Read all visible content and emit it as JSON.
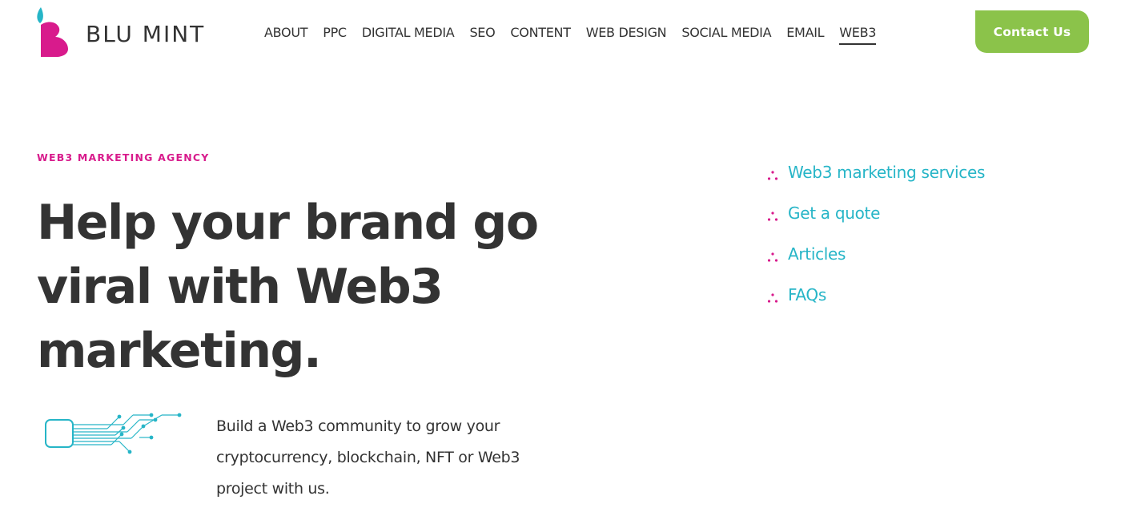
{
  "brand": {
    "name": "BLU MINT",
    "colors": {
      "pink": "#d81b8c",
      "teal": "#26b5c7",
      "green": "#8bc34a",
      "dark": "#333333"
    }
  },
  "nav": {
    "items": [
      {
        "label": "ABOUT"
      },
      {
        "label": "PPC"
      },
      {
        "label": "DIGITAL MEDIA"
      },
      {
        "label": "SEO"
      },
      {
        "label": "CONTENT"
      },
      {
        "label": "WEB DESIGN"
      },
      {
        "label": "SOCIAL MEDIA"
      },
      {
        "label": "EMAIL"
      },
      {
        "label": "WEB3",
        "active": true
      }
    ],
    "contact_label": "Contact Us"
  },
  "hero": {
    "eyebrow": "WEB3 MARKETING AGENCY",
    "headline": "Help your brand go viral with Web3 marketing.",
    "description": "Build a Web3 community to grow your cryptocurrency, blockchain, NFT or Web3 project with us.",
    "illustration_icon": "circuit-icon"
  },
  "quick_links": {
    "bullet_icon": "triangle-dots-icon",
    "items": [
      {
        "label": "Web3 marketing services"
      },
      {
        "label": "Get a quote"
      },
      {
        "label": "Articles"
      },
      {
        "label": "FAQs"
      }
    ]
  }
}
